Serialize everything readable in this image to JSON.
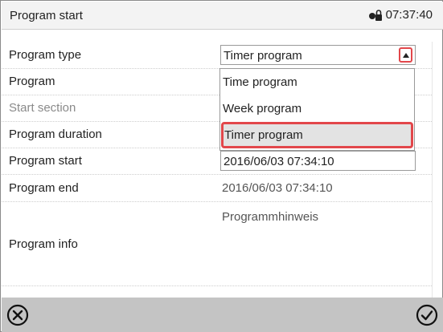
{
  "window": {
    "title": "Program start",
    "clock": "07:37:40"
  },
  "rows": {
    "program_type": {
      "label": "Program type",
      "value": "Timer program"
    },
    "program": {
      "label": "Program"
    },
    "start_section": {
      "label": "Start section"
    },
    "program_duration": {
      "label": "Program duration"
    },
    "program_start": {
      "label": "Program start",
      "value": "2016/06/03 07:34:10"
    },
    "program_end": {
      "label": "Program end",
      "value": "2016/06/03 07:34:10"
    },
    "program_info": {
      "label": "Program info",
      "hint": "Programmhinweis"
    }
  },
  "dropdown": {
    "options": [
      "Time program",
      "Week program",
      "Timer program"
    ],
    "selected": "Timer program"
  },
  "icons": {
    "lock": "lock-icon",
    "cancel": "cancel-icon",
    "confirm": "confirm-icon",
    "dropdown_arrow": "triangle-up-icon"
  },
  "colors": {
    "highlight": "#e2474b",
    "footer": "#c4c4c4"
  }
}
